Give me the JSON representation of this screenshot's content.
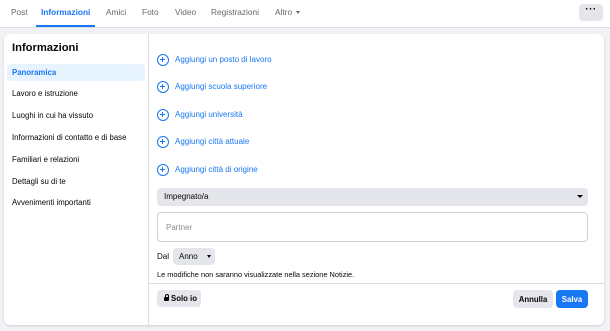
{
  "tabs": [
    {
      "label": "Post",
      "active": false
    },
    {
      "label": "Informazioni",
      "active": true
    },
    {
      "label": "Amici",
      "active": false
    },
    {
      "label": "Foto",
      "active": false
    },
    {
      "label": "Video",
      "active": false
    },
    {
      "label": "Registrazioni",
      "active": false
    },
    {
      "label": "Altro",
      "active": false
    }
  ],
  "more_button": {
    "label": "···"
  },
  "sidebar": {
    "title": "Informazioni",
    "items": [
      {
        "label": "Panoramica",
        "active": true
      },
      {
        "label": "Lavoro e istruzione"
      },
      {
        "label": "Luoghi in cui ha vissuto"
      },
      {
        "label": "Informazioni di contatto e di base"
      },
      {
        "label": "Familiari e relazioni"
      },
      {
        "label": "Dettagli su di te"
      },
      {
        "label": "Avvenimenti importanti"
      }
    ]
  },
  "add_links": [
    {
      "label": "Aggiungi un posto di lavoro",
      "icon": "plus-circle-icon"
    },
    {
      "label": "Aggiungi scuola superiore",
      "icon": "plus-circle-icon"
    },
    {
      "label": "Aggiungi università",
      "icon": "plus-circle-icon"
    },
    {
      "label": "Aggiungi città attuale",
      "icon": "plus-circle-icon"
    },
    {
      "label": "Aggiungi città di origine",
      "icon": "plus-circle-icon"
    }
  ],
  "relationship": {
    "status_value": "Impegnato/a",
    "partner_placeholder": "Partner",
    "since_label": "Dal",
    "year_value": "Anno",
    "notice": "Le modifiche non saranno visualizzate nella sezione Notizie."
  },
  "footer": {
    "privacy_label": "Solo io",
    "privacy_icon": "lock-icon",
    "cancel_label": "Annulla",
    "save_label": "Salva"
  },
  "colors": {
    "accent": "#1877f2",
    "active_bg": "#e7f3ff",
    "button_gray": "#e4e6eb",
    "page_bg": "#f0f2f5"
  }
}
